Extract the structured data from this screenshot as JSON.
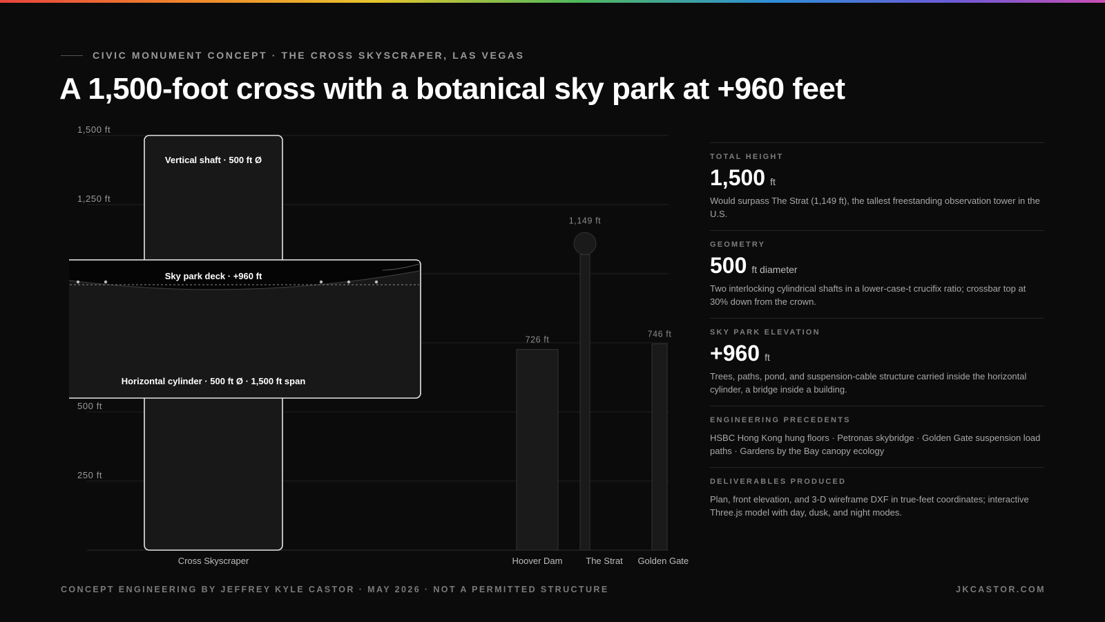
{
  "eyebrow": "CIVIC MONUMENT CONCEPT · THE CROSS SKYSCRAPER, LAS VEGAS",
  "headline": "A 1,500-foot cross with a botanical sky park at +960 feet",
  "chart_data": {
    "type": "bar",
    "ylim": [
      0,
      1500
    ],
    "y_ticks": [
      {
        "value": 250,
        "label": "250 ft"
      },
      {
        "value": 500,
        "label": "500 ft"
      },
      {
        "value": 1250,
        "label": "1,250 ft"
      },
      {
        "value": 1500,
        "label": "1,500 ft"
      }
    ],
    "hidden_grid_values": [
      750,
      1000
    ],
    "cross": {
      "name": "Cross Skyscraper",
      "height": 1500,
      "shaft_label": "Vertical shaft · 500 ft Ø",
      "cylinder_bottom": 550,
      "cylinder_top": 1050,
      "cylinder_label": "Horizontal cylinder · 500 ft Ø · 1,500 ft span",
      "deck_elevation": 960,
      "deck_label": "Sky park deck · +960 ft"
    },
    "comparisons": [
      {
        "name": "Hoover Dam",
        "value": 726,
        "label": "726 ft"
      },
      {
        "name": "The Strat",
        "value": 1149,
        "label": "1,149 ft"
      },
      {
        "name": "Golden Gate tower",
        "value": 746,
        "label": "746 ft"
      }
    ]
  },
  "stats": [
    {
      "label": "TOTAL HEIGHT",
      "value": "1,500",
      "unit": "ft",
      "desc": "Would surpass The Strat (1,149 ft), the tallest freestanding observation tower in the U.S."
    },
    {
      "label": "GEOMETRY",
      "value": "500",
      "unit": "ft diameter",
      "desc": "Two interlocking cylindrical shafts in a lower-case-t crucifix ratio; crossbar top at 30% down from the crown."
    },
    {
      "label": "SKY PARK ELEVATION",
      "value": "+960",
      "unit": "ft",
      "desc": "Trees, paths, pond, and suspension-cable structure carried inside the horizontal cylinder, a bridge inside a building."
    },
    {
      "label": "ENGINEERING PRECEDENTS",
      "desc": "HSBC Hong Kong hung floors · Petronas skybridge · Golden Gate suspension load paths · Gardens by the Bay canopy ecology"
    },
    {
      "label": "DELIVERABLES PRODUCED",
      "desc": "Plan, front elevation, and 3-D wireframe DXF in true-feet coordinates; interactive Three.js model with day, dusk, and night modes."
    }
  ],
  "footer": {
    "left": "CONCEPT ENGINEERING BY JEFFREY KYLE CASTOR · MAY 2026 · NOT A PERMITTED STRUCTURE",
    "right": "JKCASTOR.COM"
  }
}
